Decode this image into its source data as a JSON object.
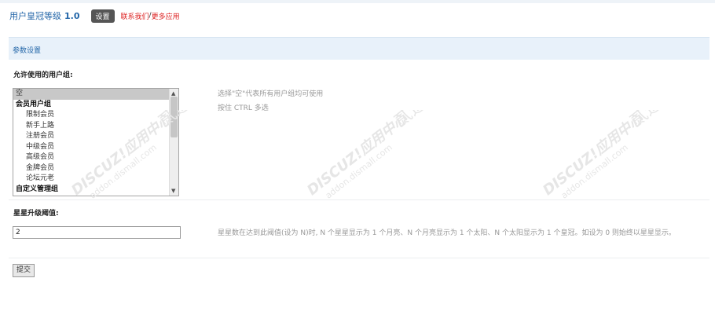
{
  "header": {
    "app_title": "用户皇冠等级",
    "version": "1.0",
    "settings_button": "设置",
    "contact_link": "联系我们",
    "separator": "/",
    "more_apps_link": "更多应用"
  },
  "section": {
    "title": "参数设置"
  },
  "group_setting": {
    "label": "允许使用的用户组:",
    "options": [
      {
        "label": "空",
        "selected": true,
        "type": "none"
      },
      {
        "label": "会员用户组",
        "selected": false,
        "type": "group"
      },
      {
        "label": "限制会员",
        "selected": false,
        "type": "item"
      },
      {
        "label": "新手上路",
        "selected": false,
        "type": "item"
      },
      {
        "label": "注册会员",
        "selected": false,
        "type": "item"
      },
      {
        "label": "中级会员",
        "selected": false,
        "type": "item"
      },
      {
        "label": "高级会员",
        "selected": false,
        "type": "item"
      },
      {
        "label": "金牌会员",
        "selected": false,
        "type": "item"
      },
      {
        "label": "论坛元老",
        "selected": false,
        "type": "item"
      },
      {
        "label": "自定义管理组",
        "selected": false,
        "type": "group"
      }
    ],
    "hint_line1": "选择\"空\"代表所有用户组均可使用",
    "hint_line2": "按住 CTRL 多选"
  },
  "threshold_setting": {
    "label": "星星升级阈值:",
    "value": "2",
    "hint": "星星数在达到此阈值(设为 N)时, N 个星星显示为 1 个月亮、N 个月亮显示为 1 个太阳、N 个太阳显示为 1 个皇冠。如设为 0 则始终以星星显示。"
  },
  "submit_button": "提交",
  "watermark": {
    "text1": "DISCUZ!应用中心",
    "text2": "addon.dismall.com",
    "brand": "贰道",
    "mark": "®"
  }
}
